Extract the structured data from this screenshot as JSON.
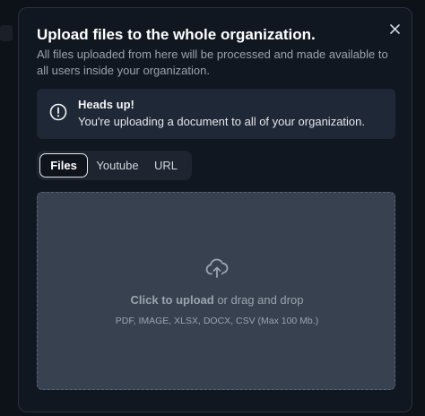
{
  "dialog": {
    "title": "Upload files to the whole organization.",
    "subtitle": "All files uploaded from here will be processed and made available to all users inside your organization.",
    "close_icon": "close-icon"
  },
  "alert": {
    "icon": "alert-circle-icon",
    "title": "Heads up!",
    "message": "You're uploading a document to all of your organization."
  },
  "tabs": [
    {
      "label": "Files",
      "active": true
    },
    {
      "label": "Youtube",
      "active": false
    },
    {
      "label": "URL",
      "active": false
    }
  ],
  "dropzone": {
    "icon": "cloud-upload-icon",
    "cta": "Click to upload",
    "cta_suffix": " or drag and drop",
    "hint": "PDF, IMAGE, XLSX, DOCX, CSV (Max 100 Mb.)"
  },
  "colors": {
    "modal_bg": "#111720",
    "alert_bg": "#1f2836",
    "dropzone_bg": "#38414f",
    "text_primary": "#ffffff",
    "text_muted": "#9aa3af"
  }
}
